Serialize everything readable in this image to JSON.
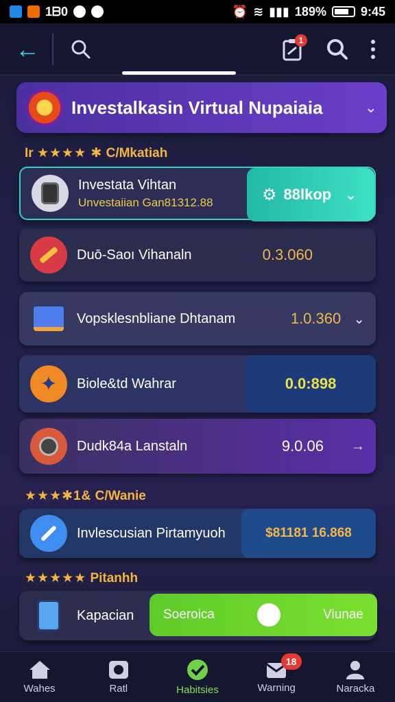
{
  "status_bar": {
    "left_text": "1ᗷ0",
    "battery": "189%",
    "time": "9:45"
  },
  "app_bar": {
    "back_icon": "arrow-left-icon",
    "search_icon": "search-icon",
    "clipboard_badge": "1",
    "right_search_icon": "search-icon",
    "more_icon": "more-vert-icon"
  },
  "header": {
    "title": "Investalkasin Virtual Nupaiaia"
  },
  "sections": {
    "first": {
      "stars": "★★★★ ✱",
      "label": "C/Mkatiah",
      "prefix": "I⁠r"
    },
    "second": {
      "stars": "★★★✱1&",
      "label": "C/Wanie"
    },
    "third": {
      "stars": "★★★★★",
      "label": "Pitanhh"
    }
  },
  "rows": [
    {
      "title": "Investata Vihtan",
      "subtitle": "Unvestaiian Gan81312.88",
      "value": "88lkop",
      "accent": "#34d1bf"
    },
    {
      "title": "Duō-Saoı Vihanaln",
      "value": "0.3.060",
      "value_color": "#f3b74a"
    },
    {
      "title": "Vopsklesnbliane Dhtanam",
      "value": "1.0.360",
      "value_color": "#f3b74a"
    },
    {
      "title": "Biole&td Wahrar",
      "value": "0.0:898",
      "value_color": "#e9e34a"
    },
    {
      "title": "Dudk84a Lanstaln",
      "value": "9.0.06",
      "value_color": "#ffffff"
    },
    {
      "title": "Invlescusian Pirtamyuoh",
      "value": "$81181 16.868",
      "value_color": "#f3b74a"
    },
    {
      "title": "Kapacian",
      "pill_left": "Soeroica",
      "pill_right": "Viunae"
    }
  ],
  "bottom_nav": [
    {
      "label": "Wahes",
      "icon": "home-icon"
    },
    {
      "label": "Ratl",
      "icon": "chart-icon"
    },
    {
      "label": "Habitsies",
      "icon": "check-circle-icon",
      "active": true
    },
    {
      "label": "Warning",
      "icon": "mail-icon",
      "badge": "18"
    },
    {
      "label": "Naracka",
      "icon": "person-icon"
    }
  ],
  "colors": {
    "accent_teal": "#34d1bf",
    "accent_purple": "#6a3fc8",
    "accent_green": "#7de05a",
    "badge_red": "#e53935"
  }
}
